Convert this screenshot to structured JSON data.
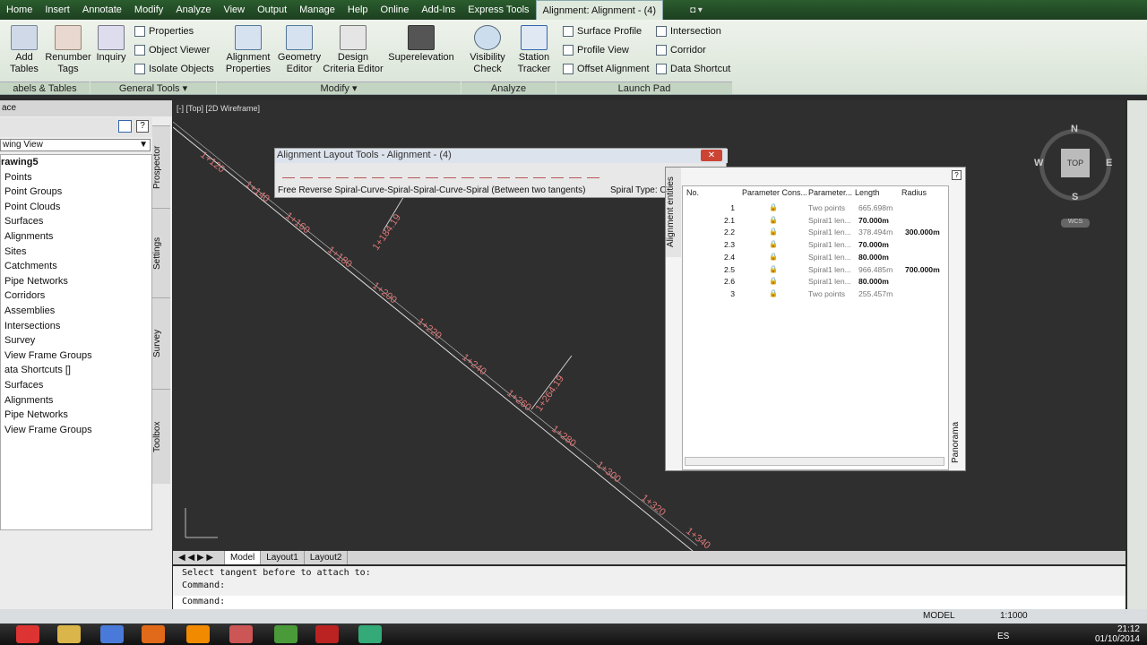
{
  "menubar": {
    "items": [
      "Home",
      "Insert",
      "Annotate",
      "Modify",
      "Analyze",
      "View",
      "Output",
      "Manage",
      "Help",
      "Online",
      "Add-Ins",
      "Express Tools",
      "Alignment: Alignment - (4)"
    ]
  },
  "ribbon": {
    "labels_tables": {
      "add_tables": "Add Tables",
      "renumber_tags": "Renumber Tags",
      "panel": "abels & Tables"
    },
    "general_tools": {
      "inquiry": "Inquiry",
      "properties": "Properties",
      "object_viewer": "Object Viewer",
      "isolate_objects": "Isolate Objects",
      "panel": "General Tools ▾"
    },
    "modify": {
      "alignment_properties": "Alignment Properties",
      "geometry_editor": "Geometry Editor",
      "design_criteria": "Design Criteria Editor",
      "superelevation": "Superelevation",
      "panel": "Modify ▾"
    },
    "analyze": {
      "visibility_check": "Visibility Check",
      "station_tracker": "Station Tracker",
      "panel": "Analyze"
    },
    "launch_pad": {
      "surface_profile": "Surface Profile",
      "profile_view": "Profile View",
      "offset_alignment": "Offset Alignment",
      "intersection": "Intersection",
      "corridor": "Corridor",
      "data_shortcut": "Data Shortcut",
      "panel": "Launch Pad"
    }
  },
  "palette": {
    "header": "ace",
    "view_select": "wing View",
    "tree": [
      "rawing5",
      "Points",
      "Point Groups",
      "Point Clouds",
      "Surfaces",
      "Alignments",
      "Sites",
      "Catchments",
      "Pipe Networks",
      "Corridors",
      "Assemblies",
      "Intersections",
      "Survey",
      "View Frame Groups",
      "ata Shortcuts []",
      "Surfaces",
      "Alignments",
      "Pipe Networks",
      "View Frame Groups"
    ],
    "tabs": [
      "Prospector",
      "Settings",
      "Survey",
      "Toolbox"
    ]
  },
  "viewport": {
    "label": "[-] [Top] [2D Wireframe]"
  },
  "stations": [
    "1+120",
    "1+140",
    "1+160",
    "1+180",
    "1+200",
    "1+220",
    "1+240",
    "1+260",
    "1+280",
    "1+300",
    "1+320",
    "1+340"
  ],
  "tags": [
    "1+184.19",
    "1+264.19"
  ],
  "layout_tools": {
    "title": "Alignment Layout Tools - Alignment - (4)",
    "description": "Free Reverse Spiral-Curve-Spiral-Spiral-Curve-Spiral (Between two tangents)",
    "spiral_type": "Spiral Type: C"
  },
  "entities": {
    "tab_label": "Alignment entities",
    "panorama": "Panorama",
    "headers": [
      "No.",
      "Parameter Cons...",
      "Parameter...",
      "Length",
      "Radius"
    ],
    "rows": [
      {
        "no": "1",
        "param": "Two points",
        "length": "665.698m",
        "radius": "",
        "bold": false
      },
      {
        "no": "2.1",
        "param": "Spiral1 len...",
        "length": "70.000m",
        "radius": "",
        "bold": true
      },
      {
        "no": "2.2",
        "param": "Spiral1 len...",
        "length": "378.494m",
        "radius": "300.000m",
        "bold": false
      },
      {
        "no": "2.3",
        "param": "Spiral1 len...",
        "length": "70.000m",
        "radius": "",
        "bold": true
      },
      {
        "no": "2.4",
        "param": "Spiral1 len...",
        "length": "80.000m",
        "radius": "",
        "bold": true
      },
      {
        "no": "2.5",
        "param": "Spiral1 len...",
        "length": "966.485m",
        "radius": "700.000m",
        "bold": false
      },
      {
        "no": "2.6",
        "param": "Spiral1 len...",
        "length": "80.000m",
        "radius": "",
        "bold": true
      },
      {
        "no": "3",
        "param": "Two points",
        "length": "255.457m",
        "radius": "",
        "bold": false
      }
    ]
  },
  "layout_tabs": [
    "Model",
    "Layout1",
    "Layout2"
  ],
  "command": {
    "line1": "Select tangent before to attach to:",
    "line2": "Command:",
    "prompt": "Command:"
  },
  "status": {
    "space": "MODEL",
    "scale": "1:1000"
  },
  "viewcube": {
    "n": "N",
    "s": "S",
    "e": "E",
    "w": "W",
    "top": "TOP",
    "wcs": "WCS"
  },
  "clock": {
    "time": "21:12",
    "date": "01/10/2014",
    "lang": "ES"
  }
}
